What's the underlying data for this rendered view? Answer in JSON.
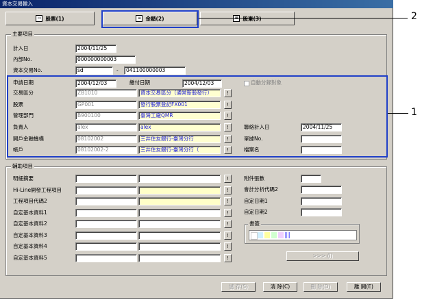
{
  "window": {
    "title": "資本交易輸入"
  },
  "tabs": [
    {
      "label": "股票(1)"
    },
    {
      "label": "金額(2)"
    },
    {
      "label": "股東(3)"
    }
  ],
  "main_group": {
    "title": "主要項目",
    "planned_date_label": "計入日",
    "planned_date_value": "2004/11/25",
    "internal_no_label": "內部No.",
    "internal_no_value": "000000000003",
    "capital_trade_no_label": "資本交易No.",
    "capital_trade_no_value": "sd",
    "capital_trade_no_sep": "-",
    "capital_trade_no_value2": "041100000003",
    "apply_date_label": "申請日期",
    "apply_date_value": "2004/12/03",
    "pay_date_label": "繳付日期",
    "pay_date_value": "2004/12/03",
    "auto_split_label": "自動分錄對象",
    "trade_type_label": "交易區分",
    "trade_type_code": "ZB1010",
    "trade_type_name": "資本交易區分（通常新股發行）",
    "stock_label": "股票",
    "stock_code": "GP001",
    "stock_name": "發行股票登記FX001",
    "dept_label": "管理部門",
    "dept_code": "B900100",
    "dept_name": "臺灣工廠QMR",
    "person_label": "負責人",
    "person_code": "alex",
    "person_name": "alex",
    "bank_label": "開戶金融機構",
    "bank_code": "08102002",
    "bank_name": "三井住友銀行-臺灣分行",
    "account_label": "帳戶",
    "account_code": "08102002-2",
    "account_name": "三井住友銀行-臺灣分行（",
    "contact_date_label": "聯絡計入日",
    "contact_date_value": "2004/11/25",
    "ledger_no_label": "單據No.",
    "ledger_no_value": "",
    "file_name_label": "檔案名",
    "file_name_value": "",
    "lookup_btn": "!"
  },
  "aux_group": {
    "title": "輔助項目",
    "rows": [
      {
        "label": "明細摘要"
      },
      {
        "label": "Hi-Line開發工程項目"
      },
      {
        "label": "工程項目代碼2"
      },
      {
        "label": "自定基本資料1"
      },
      {
        "label": "自定基本資料2"
      },
      {
        "label": "自定基本資料3"
      },
      {
        "label": "自定基本資料4"
      },
      {
        "label": "自定基本資料5"
      }
    ],
    "attach_label": "附件張數",
    "acct_split_label": "會計分析代碼2",
    "custom_date1_label": "自定日期1",
    "custom_date2_label": "自定日期2",
    "memo_title": "書簽",
    "next_btn": ">>> (I)",
    "lookup_btn": "!"
  },
  "footer": {
    "save": "儲 存(S)",
    "clear": "清 除(C)",
    "delete": "刪 除(D)",
    "close": "離 開(E)"
  },
  "callouts": {
    "one": "1",
    "two": "2"
  },
  "colors": {
    "highlight": "#1f3fc8",
    "title_bar": "#0a246a",
    "lookup_text": "#1a1ad8"
  }
}
